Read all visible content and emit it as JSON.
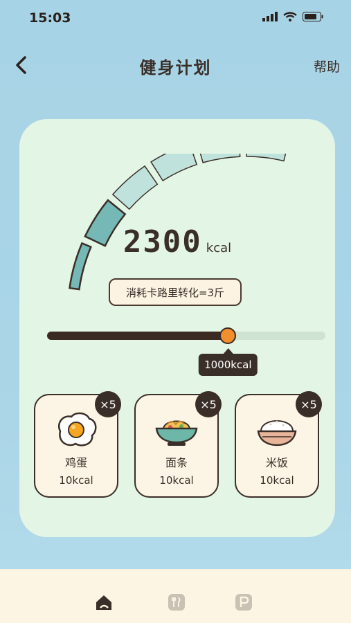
{
  "status_bar": {
    "time": "15:03"
  },
  "nav": {
    "title": "健身计划",
    "help_label": "帮助"
  },
  "gauge": {
    "value": "2300",
    "unit": "kcal",
    "segments": 6,
    "filled_segments": 2
  },
  "conversion": {
    "text": "消耗卡路里转化=3斤"
  },
  "slider": {
    "value_label": "1000kcal",
    "fraction": 0.65
  },
  "foods": [
    {
      "name": "鸡蛋",
      "kcal": "10kcal",
      "count": "×5",
      "icon": "fried-egg-icon"
    },
    {
      "name": "面条",
      "kcal": "10kcal",
      "count": "×5",
      "icon": "noodle-bowl-icon"
    },
    {
      "name": "米饭",
      "kcal": "10kcal",
      "count": "×5",
      "icon": "rice-bowl-icon"
    }
  ],
  "tabbar": {
    "tabs": [
      "home-icon",
      "fork-knife-icon",
      "parking-icon"
    ],
    "active": 0
  },
  "colors": {
    "background": "#a9d5e7",
    "card": "#e3f5e5",
    "accent": "#f08f2b",
    "dark": "#3a2e28"
  }
}
